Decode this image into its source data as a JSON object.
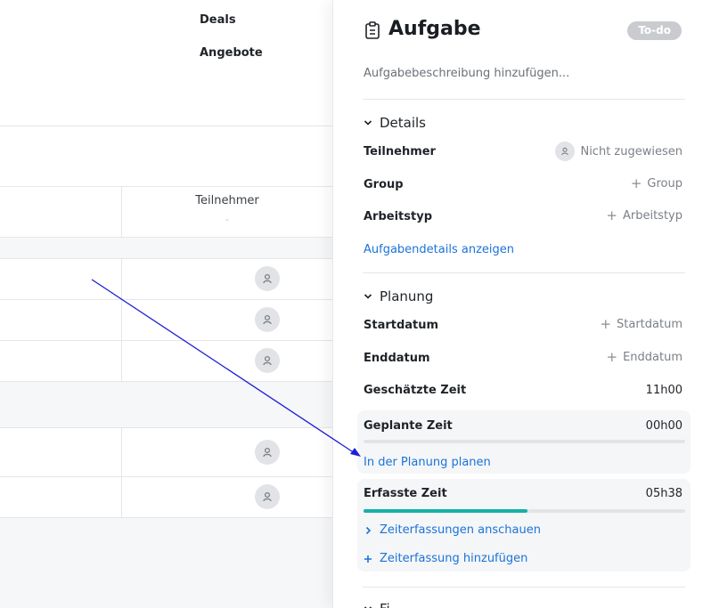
{
  "left": {
    "nav": [
      "Deals",
      "Angebote"
    ],
    "column_header": "Teilnehmer",
    "column_sub": "-",
    "rows": 5
  },
  "panel": {
    "title": "Aufgabe",
    "title_icon": "clipboard-icon",
    "status": "To-do",
    "description_placeholder": "Aufgabebeschreibung hinzufügen...",
    "details": {
      "heading": "Details",
      "participant_label": "Teilnehmer",
      "participant_value": "Nicht zugewiesen",
      "group_label": "Group",
      "group_value": "Group",
      "worktype_label": "Arbeitstyp",
      "worktype_value": "Arbeitstyp",
      "show_details_link": "Aufgabendetails anzeigen"
    },
    "planning": {
      "heading": "Planung",
      "start_label": "Startdatum",
      "start_value": "Startdatum",
      "end_label": "Enddatum",
      "end_value": "Enddatum",
      "estimated_label": "Geschätzte Zeit",
      "estimated_value": "11h00",
      "planned_label": "Geplante Zeit",
      "planned_value": "00h00",
      "planned_progress": 0,
      "plan_link": "In der Planung planen",
      "logged_label": "Erfasste Zeit",
      "logged_value": "05h38",
      "logged_progress": 0.51,
      "view_logs_link": "Zeiterfassungen anschauen",
      "add_log_link": "Zeiterfassung hinzufügen"
    },
    "next_heading": "Fi..."
  },
  "colors": {
    "accent": "#1a73d9",
    "progress": "#14b1a8",
    "badge": "#c9cbcf",
    "arrow": "#1f1fd6"
  }
}
